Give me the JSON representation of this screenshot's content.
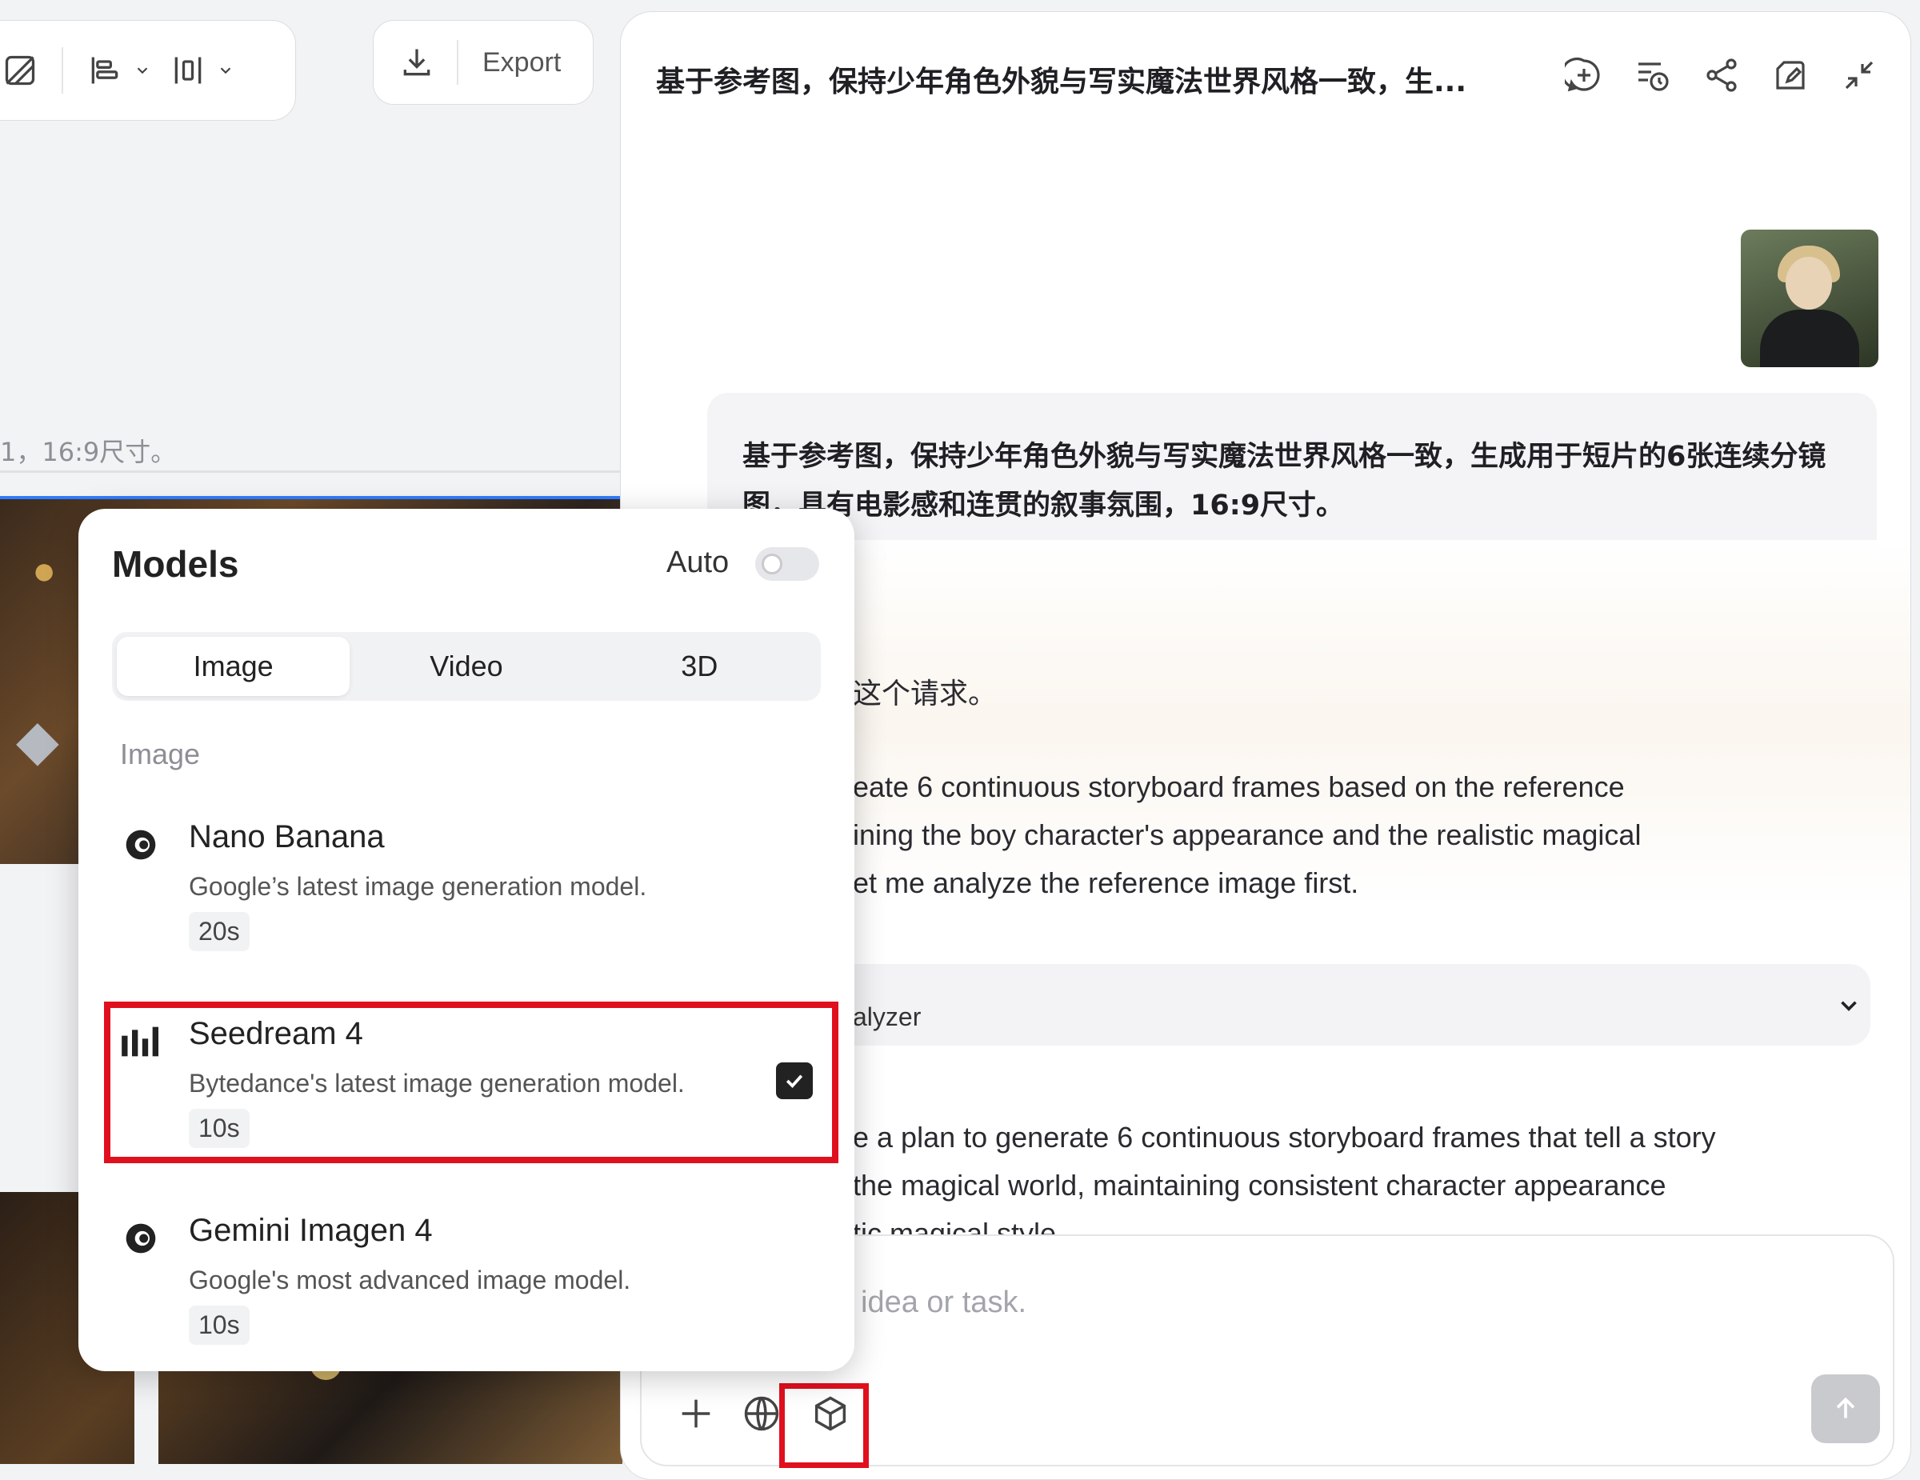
{
  "toolbar": {
    "export_label": "Export"
  },
  "canvas": {
    "caption": "1，16:9尺寸。"
  },
  "chat": {
    "title": "基于参考图，保持少年角色外貌与写实魔法世界风格一致，生...",
    "user_message": "基于参考图，保持少年角色外貌与写实魔法世界风格一致，生成用于短片的6张连续分镜图，具有电影感和连贯的叙事氛围，16:9尺寸。",
    "response_zh_fragment": "这个请求。",
    "response_lines": [
      "eate 6 continuous storyboard frames based on the reference",
      "ining the boy character's appearance and the realistic magical",
      "et me analyze the reference image first."
    ],
    "analyzer_label": "alyzer",
    "plan_lines": [
      "e a plan to generate 6 continuous storyboard frames that tell a story",
      "the magical world, maintaining consistent character appearance",
      "tic magical style."
    ],
    "input_placeholder": "idea or task."
  },
  "models": {
    "title": "Models",
    "auto_label": "Auto",
    "auto_enabled": false,
    "tabs": [
      {
        "label": "Image",
        "active": true
      },
      {
        "label": "Video",
        "active": false
      },
      {
        "label": "3D",
        "active": false
      }
    ],
    "section": "Image",
    "items": [
      {
        "name": "Nano Banana",
        "desc": "Google’s latest image generation model.",
        "time": "20s",
        "icon": "google-gemini-icon",
        "selected": false
      },
      {
        "name": "Seedream 4",
        "desc": "Bytedance's latest image generation model.",
        "time": "10s",
        "icon": "bytedance-icon",
        "selected": true
      },
      {
        "name": "Gemini Imagen 4",
        "desc": "Google's most advanced image model.",
        "time": "10s",
        "icon": "google-gemini-icon",
        "selected": false
      }
    ]
  },
  "colors": {
    "highlight": "#e0101e",
    "accent_blue": "#2f7bff"
  }
}
